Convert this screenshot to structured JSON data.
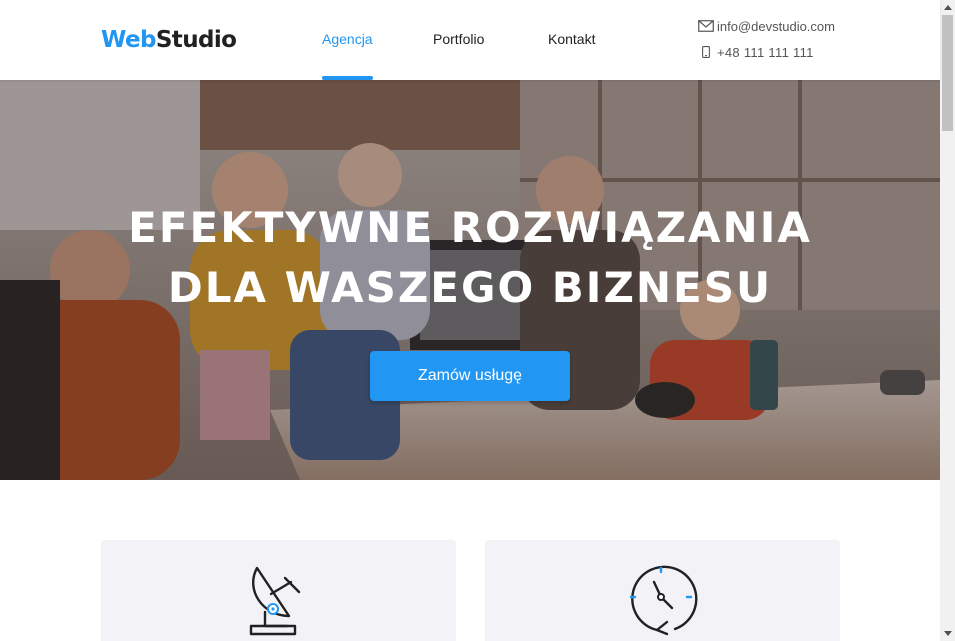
{
  "brand": {
    "part1": "Web",
    "part2": "Studio",
    "accent": "#2196f3",
    "dark": "#212121"
  },
  "nav": {
    "items": [
      {
        "label": "Agencja",
        "active": true
      },
      {
        "label": "Portfolio",
        "active": false
      },
      {
        "label": "Kontakt",
        "active": false
      }
    ]
  },
  "contacts": {
    "email": {
      "icon": "mail-icon",
      "text": "info@devstudio.com"
    },
    "phone": {
      "icon": "phone-icon",
      "text": "+48 111 111 111"
    }
  },
  "hero": {
    "title_line1": "Efektywne rozwiązania",
    "title_line2": "dla waszego biznesu",
    "cta_label": "Zamów usługę"
  },
  "features": [
    {
      "icon": "satellite-dish-icon"
    },
    {
      "icon": "clock-refresh-icon"
    }
  ]
}
